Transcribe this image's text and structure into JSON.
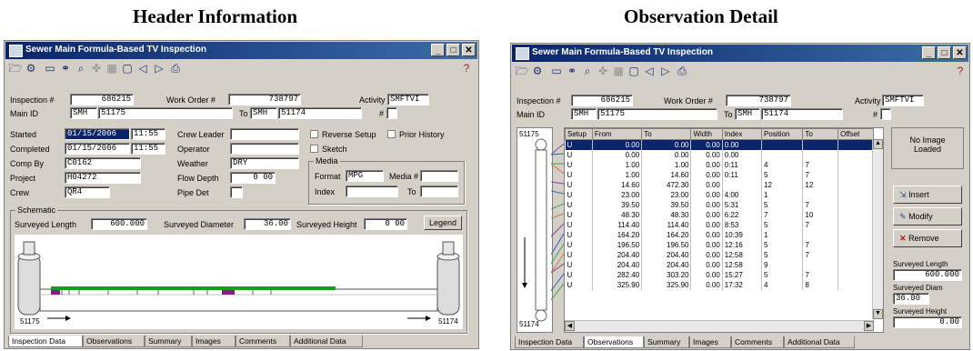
{
  "headings": {
    "left": "Header Information",
    "right": "Observation Detail"
  },
  "title": "Sewer Main Formula-Based TV Inspection",
  "header": {
    "inspection_label": "Inspection #",
    "inspection_value": "686215",
    "work_order_label": "Work Order #",
    "work_order_value": "738797",
    "activity_label": "Activity",
    "activity_value": "SMFTVI",
    "main_id_label": "Main ID",
    "from_type": "SMH",
    "from_id": "51175",
    "to_label": "To",
    "to_type": "SMH",
    "to_id": "51174",
    "hash_label": "#"
  },
  "form": {
    "started_label": "Started",
    "started_date": "01/15/2006",
    "started_time": "11:55",
    "completed_label": "Completed",
    "completed_date": "01/15/2006",
    "completed_time": "11:55",
    "comp_by_label": "Comp By",
    "comp_by_value": "C0162",
    "project_label": "Project",
    "project_value": "H04272",
    "crew_label": "Crew",
    "crew_value": "QR4",
    "crew_leader_label": "Crew Leader",
    "operator_label": "Operator",
    "weather_label": "Weather",
    "weather_value": "DRY",
    "flow_depth_label": "Flow Depth",
    "flow_depth_value": "0 00",
    "pipe_det_label": "Pipe Det",
    "reverse_setup_label": "Reverse Setup",
    "prior_history_label": "Prior History",
    "sketch_label": "Sketch",
    "media_label": "Media",
    "format_label": "Format",
    "format_value": "MPG",
    "media_num_label": "Media #",
    "index_label": "Index",
    "index_to_label": "To"
  },
  "schematic": {
    "label": "Schematic",
    "surveyed_length_label": "Surveyed Length",
    "surveyed_length_value": "600.000",
    "surveyed_diameter_label": "Surveyed Diameter",
    "surveyed_diameter_value": "36.00",
    "surveyed_height_label": "Surveyed Height",
    "surveyed_height_value": "0 00",
    "legend_button": "Legend",
    "start_node": "51175",
    "end_node": "51174"
  },
  "tabs": [
    "Inspection Data",
    "Observations",
    "Summary",
    "Images",
    "Comments",
    "Additional Data"
  ],
  "obs": {
    "top_node": "51175",
    "bottom_node": "51174",
    "columns": [
      "Setup",
      "From",
      "To",
      "Width",
      "Index",
      "Position",
      "To",
      "Offset"
    ],
    "rows": [
      [
        "U",
        "0.00",
        "0.00",
        "0.00",
        "0.00",
        "",
        "",
        ""
      ],
      [
        "U",
        "0.00",
        "0.00",
        "0.00",
        "0.00",
        "",
        "",
        ""
      ],
      [
        "U",
        "1.00",
        "1.00",
        "0.00",
        "0:11",
        "4",
        "7",
        ""
      ],
      [
        "U",
        "1.00",
        "14.60",
        "0.00",
        "0:11",
        "5",
        "7",
        ""
      ],
      [
        "U",
        "14.60",
        "472.30",
        "0.00",
        "",
        "12",
        "12",
        ""
      ],
      [
        "U",
        "23.00",
        "23.00",
        "0.00",
        "4:00",
        "1",
        "",
        ""
      ],
      [
        "U",
        "39.50",
        "39.50",
        "0.00",
        "5:31",
        "5",
        "7",
        ""
      ],
      [
        "U",
        "48.30",
        "48.30",
        "0.00",
        "6:22",
        "7",
        "10",
        ""
      ],
      [
        "U",
        "114.40",
        "114.40",
        "0.00",
        "8:53",
        "5",
        "7",
        ""
      ],
      [
        "U",
        "164.20",
        "164.20",
        "0.00",
        "10:39",
        "1",
        "",
        ""
      ],
      [
        "U",
        "196.50",
        "196.50",
        "0.00",
        "12:16",
        "5",
        "7",
        ""
      ],
      [
        "U",
        "204.40",
        "204.40",
        "0.00",
        "12:58",
        "5",
        "7",
        ""
      ],
      [
        "U",
        "204.40",
        "204.40",
        "0.00",
        "12:58",
        "9",
        "",
        ""
      ],
      [
        "U",
        "282.40",
        "303.20",
        "0.00",
        "15:27",
        "5",
        "7",
        ""
      ],
      [
        "U",
        "325.90",
        "325.90",
        "0.00",
        "17:32",
        "4",
        "8",
        ""
      ]
    ],
    "no_image": "No Image Loaded",
    "insert_button": "Insert",
    "modify_button": "Modify",
    "remove_button": "Remove",
    "surveyed_length_label": "Surveyed Length",
    "surveyed_length_value": "600.000",
    "surveyed_diam_label": "Surveyed Diam",
    "surveyed_diam_value": "36.00",
    "surveyed_height_label": "Surveyed Height",
    "surveyed_height_value": "0.00"
  },
  "colors": {
    "title_bar": "#0a246a",
    "selection": "#0a246a",
    "pipe_green": "#1a9a20",
    "pipe_purple": "#8a1a8a"
  },
  "icons": [
    "open-folder-icon",
    "connect-icon",
    "computer-icon",
    "binoculars-icon",
    "zoom-icon",
    "tools-icon",
    "grid-icon",
    "document-icon",
    "prev-arrow-icon",
    "next-arrow-icon",
    "print-icon",
    "help-icon"
  ]
}
